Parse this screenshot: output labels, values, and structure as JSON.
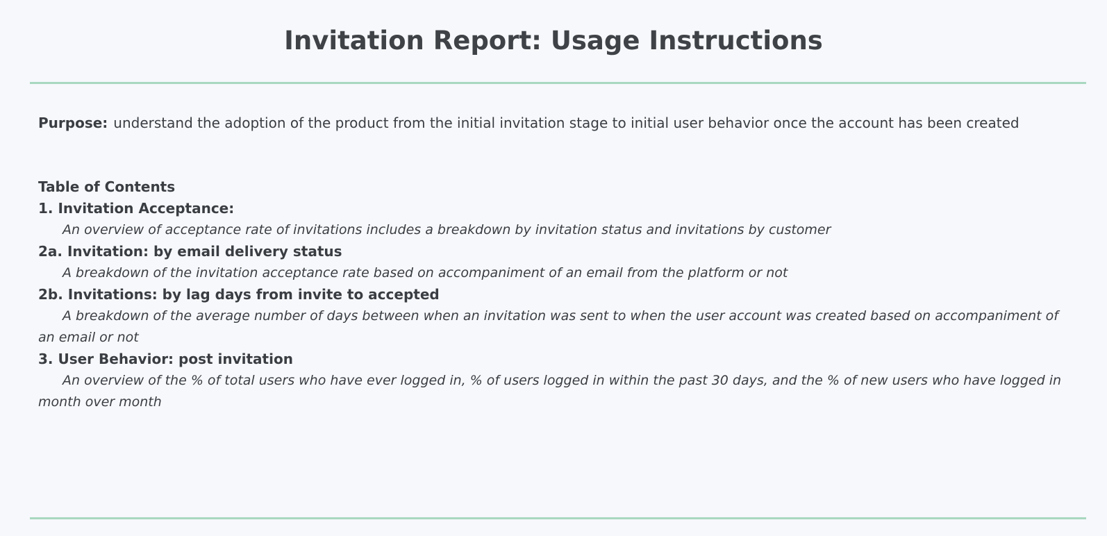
{
  "title": "Invitation Report: Usage Instructions",
  "purpose": {
    "label": "Purpose:",
    "text": "understand the adoption of the product from the initial invitation stage to initial user behavior once the account has been created"
  },
  "toc": {
    "heading": "Table of Contents",
    "items": [
      {
        "title": "1. Invitation Acceptance:",
        "description": "An overview of acceptance rate of invitations includes a breakdown by invitation status and invitations by customer"
      },
      {
        "title": "2a. Invitation: by email delivery status",
        "description": "A breakdown of the invitation acceptance rate based on accompaniment of an email from the platform or not"
      },
      {
        "title": "2b. Invitations: by lag days from invite to accepted",
        "description": "A breakdown of the average number of days between when an invitation was sent to when the user account was created based on accompaniment of an email or not"
      },
      {
        "title": "3. User Behavior: post invitation",
        "description": "An overview of the % of total users who have ever logged in, % of users logged in within the past 30 days, and the % of new users who have logged in month over month"
      }
    ]
  },
  "colors": {
    "background": "#f6f8fb",
    "text": "#3a3d42",
    "rule": "#a9d8c0"
  }
}
